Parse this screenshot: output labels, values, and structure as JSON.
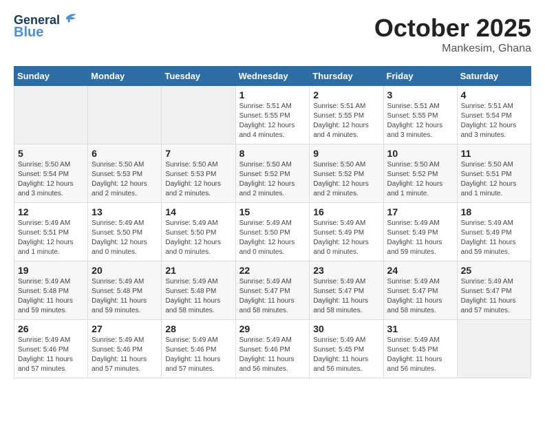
{
  "header": {
    "logo_line1": "General",
    "logo_line2": "Blue",
    "month": "October 2025",
    "location": "Mankesim, Ghana"
  },
  "weekdays": [
    "Sunday",
    "Monday",
    "Tuesday",
    "Wednesday",
    "Thursday",
    "Friday",
    "Saturday"
  ],
  "weeks": [
    [
      {
        "day": "",
        "info": ""
      },
      {
        "day": "",
        "info": ""
      },
      {
        "day": "",
        "info": ""
      },
      {
        "day": "1",
        "info": "Sunrise: 5:51 AM\nSunset: 5:55 PM\nDaylight: 12 hours\nand 4 minutes."
      },
      {
        "day": "2",
        "info": "Sunrise: 5:51 AM\nSunset: 5:55 PM\nDaylight: 12 hours\nand 4 minutes."
      },
      {
        "day": "3",
        "info": "Sunrise: 5:51 AM\nSunset: 5:55 PM\nDaylight: 12 hours\nand 3 minutes."
      },
      {
        "day": "4",
        "info": "Sunrise: 5:51 AM\nSunset: 5:54 PM\nDaylight: 12 hours\nand 3 minutes."
      }
    ],
    [
      {
        "day": "5",
        "info": "Sunrise: 5:50 AM\nSunset: 5:54 PM\nDaylight: 12 hours\nand 3 minutes."
      },
      {
        "day": "6",
        "info": "Sunrise: 5:50 AM\nSunset: 5:53 PM\nDaylight: 12 hours\nand 2 minutes."
      },
      {
        "day": "7",
        "info": "Sunrise: 5:50 AM\nSunset: 5:53 PM\nDaylight: 12 hours\nand 2 minutes."
      },
      {
        "day": "8",
        "info": "Sunrise: 5:50 AM\nSunset: 5:52 PM\nDaylight: 12 hours\nand 2 minutes."
      },
      {
        "day": "9",
        "info": "Sunrise: 5:50 AM\nSunset: 5:52 PM\nDaylight: 12 hours\nand 2 minutes."
      },
      {
        "day": "10",
        "info": "Sunrise: 5:50 AM\nSunset: 5:52 PM\nDaylight: 12 hours\nand 1 minute."
      },
      {
        "day": "11",
        "info": "Sunrise: 5:50 AM\nSunset: 5:51 PM\nDaylight: 12 hours\nand 1 minute."
      }
    ],
    [
      {
        "day": "12",
        "info": "Sunrise: 5:49 AM\nSunset: 5:51 PM\nDaylight: 12 hours\nand 1 minute."
      },
      {
        "day": "13",
        "info": "Sunrise: 5:49 AM\nSunset: 5:50 PM\nDaylight: 12 hours\nand 0 minutes."
      },
      {
        "day": "14",
        "info": "Sunrise: 5:49 AM\nSunset: 5:50 PM\nDaylight: 12 hours\nand 0 minutes."
      },
      {
        "day": "15",
        "info": "Sunrise: 5:49 AM\nSunset: 5:50 PM\nDaylight: 12 hours\nand 0 minutes."
      },
      {
        "day": "16",
        "info": "Sunrise: 5:49 AM\nSunset: 5:49 PM\nDaylight: 12 hours\nand 0 minutes."
      },
      {
        "day": "17",
        "info": "Sunrise: 5:49 AM\nSunset: 5:49 PM\nDaylight: 11 hours\nand 59 minutes."
      },
      {
        "day": "18",
        "info": "Sunrise: 5:49 AM\nSunset: 5:49 PM\nDaylight: 11 hours\nand 59 minutes."
      }
    ],
    [
      {
        "day": "19",
        "info": "Sunrise: 5:49 AM\nSunset: 5:48 PM\nDaylight: 11 hours\nand 59 minutes."
      },
      {
        "day": "20",
        "info": "Sunrise: 5:49 AM\nSunset: 5:48 PM\nDaylight: 11 hours\nand 59 minutes."
      },
      {
        "day": "21",
        "info": "Sunrise: 5:49 AM\nSunset: 5:48 PM\nDaylight: 11 hours\nand 58 minutes."
      },
      {
        "day": "22",
        "info": "Sunrise: 5:49 AM\nSunset: 5:47 PM\nDaylight: 11 hours\nand 58 minutes."
      },
      {
        "day": "23",
        "info": "Sunrise: 5:49 AM\nSunset: 5:47 PM\nDaylight: 11 hours\nand 58 minutes."
      },
      {
        "day": "24",
        "info": "Sunrise: 5:49 AM\nSunset: 5:47 PM\nDaylight: 11 hours\nand 58 minutes."
      },
      {
        "day": "25",
        "info": "Sunrise: 5:49 AM\nSunset: 5:47 PM\nDaylight: 11 hours\nand 57 minutes."
      }
    ],
    [
      {
        "day": "26",
        "info": "Sunrise: 5:49 AM\nSunset: 5:46 PM\nDaylight: 11 hours\nand 57 minutes."
      },
      {
        "day": "27",
        "info": "Sunrise: 5:49 AM\nSunset: 5:46 PM\nDaylight: 11 hours\nand 57 minutes."
      },
      {
        "day": "28",
        "info": "Sunrise: 5:49 AM\nSunset: 5:46 PM\nDaylight: 11 hours\nand 57 minutes."
      },
      {
        "day": "29",
        "info": "Sunrise: 5:49 AM\nSunset: 5:46 PM\nDaylight: 11 hours\nand 56 minutes."
      },
      {
        "day": "30",
        "info": "Sunrise: 5:49 AM\nSunset: 5:45 PM\nDaylight: 11 hours\nand 56 minutes."
      },
      {
        "day": "31",
        "info": "Sunrise: 5:49 AM\nSunset: 5:45 PM\nDaylight: 11 hours\nand 56 minutes."
      },
      {
        "day": "",
        "info": ""
      }
    ]
  ]
}
